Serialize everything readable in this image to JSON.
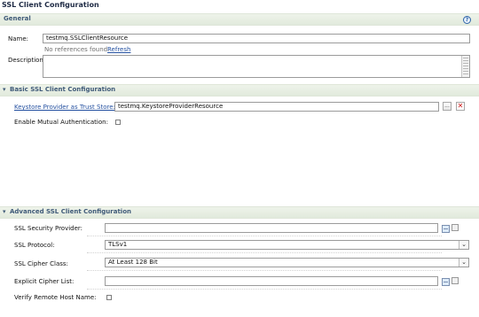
{
  "page": {
    "title": "SSL Client Configuration"
  },
  "general": {
    "header": "General",
    "help_icon": "help-icon",
    "name_label": "Name:",
    "name_value": "testmq.SSLClientResource",
    "references_note": "No references found.",
    "refresh_link": "Refresh",
    "description_label": "Description:",
    "description_value": ""
  },
  "basic": {
    "header": "Basic SSL Client Configuration",
    "keystore_label": "Keystore Provider as Trust Store:",
    "keystore_value": "testmq.KeystoreProviderResource",
    "browse_label": "...",
    "delete_icon": "close-icon",
    "mutual_auth_label": "Enable Mutual Authentication:",
    "mutual_auth_checked": false
  },
  "advanced": {
    "header": "Advanced SSL Client Configuration",
    "security_provider_label": "SSL Security Provider:",
    "security_provider_value": "",
    "protocol_label": "SSL Protocol:",
    "protocol_value": "TLSv1",
    "cipher_class_label": "SSL Cipher Class:",
    "cipher_class_value": "At Least 128 Bit",
    "cipher_list_label": "Explicit Cipher List:",
    "cipher_list_value": "",
    "verify_host_label": "Verify Remote Host Name:",
    "verify_host_checked": false
  }
}
